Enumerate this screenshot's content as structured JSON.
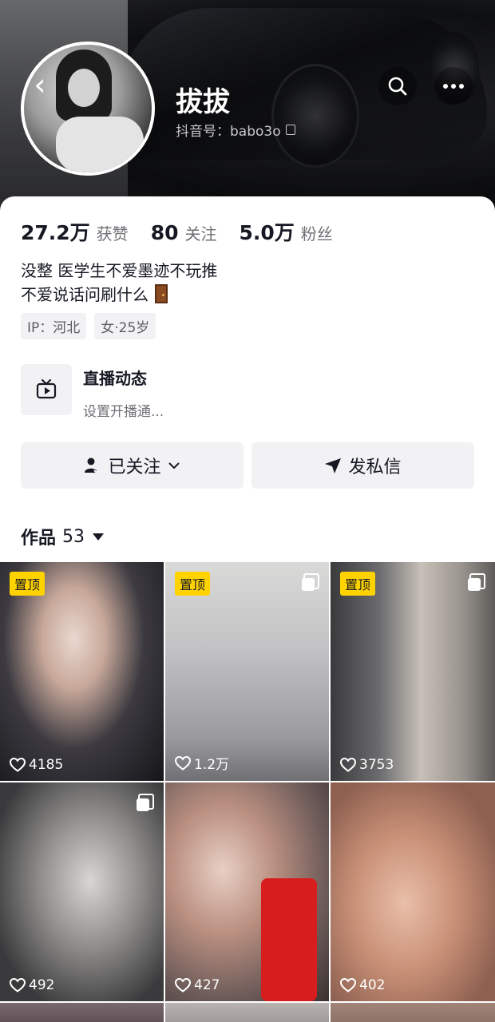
{
  "profile": {
    "nickname": "拔拔",
    "douyin_id": "抖音号：babo3o"
  },
  "stats": [
    {
      "value": "27.2万",
      "label": "获赞"
    },
    {
      "value": "80",
      "label": "关注"
    },
    {
      "value": "5.0万",
      "label": "粉丝"
    }
  ],
  "bio": {
    "line1": "没整 医学生不爱墨迹不玩推",
    "line2": "不爱说话问刷什么"
  },
  "tags": [
    "IP：河北",
    "女·25岁"
  ],
  "live": {
    "title": "直播动态",
    "subtitle": "设置开播通..."
  },
  "actions": {
    "follow_label": "已关注",
    "message_label": "发私信"
  },
  "works": {
    "label": "作品",
    "count": "53"
  },
  "pinned_label": "置顶",
  "videos": [
    {
      "likes": "4185",
      "pinned": true,
      "multi": false
    },
    {
      "likes": "1.2万",
      "pinned": true,
      "multi": true
    },
    {
      "likes": "3753",
      "pinned": true,
      "multi": true
    },
    {
      "likes": "492",
      "pinned": false,
      "multi": true
    },
    {
      "likes": "427",
      "pinned": false,
      "multi": false
    },
    {
      "likes": "402",
      "pinned": false,
      "multi": false
    }
  ]
}
